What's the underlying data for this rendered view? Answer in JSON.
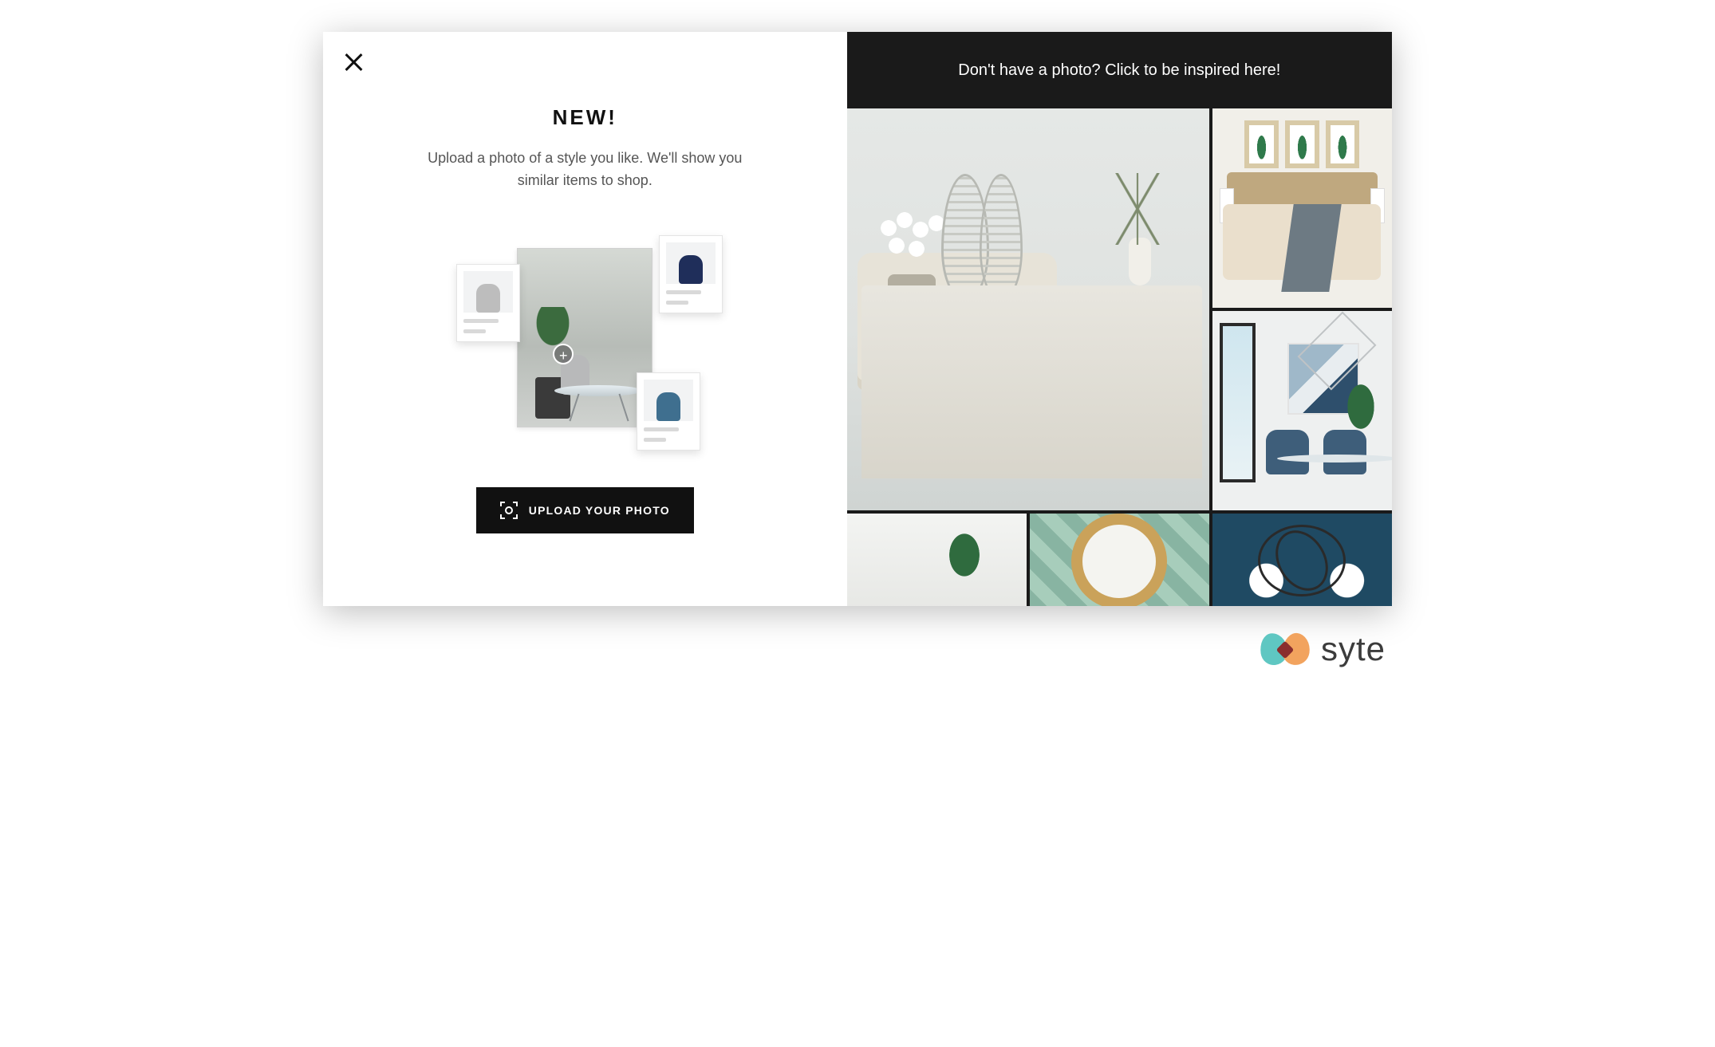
{
  "left": {
    "headline": "NEW!",
    "subtext": "Upload a photo of a style you like. We'll show you similar items to shop.",
    "upload_button_label": "UPLOAD YOUR PHOTO"
  },
  "right": {
    "inspire_bar_text": "Don't have a photo? Click to be inspired here!"
  },
  "brand": {
    "name": "syte"
  }
}
